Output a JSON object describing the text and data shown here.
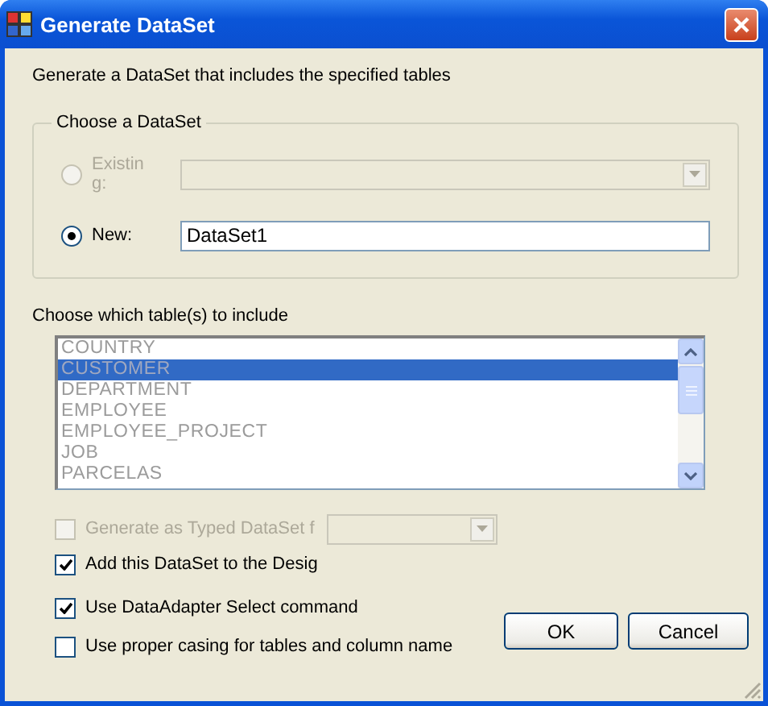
{
  "window": {
    "title": "Generate DataSet"
  },
  "description": "Generate a DataSet that includes the specified tables",
  "dataset_group": {
    "legend": "Choose a DataSet",
    "choices": [
      {
        "kind": "combo",
        "label": "Existing:",
        "selected": false,
        "disabled": true
      },
      {
        "kind": "field",
        "label": "New:",
        "selected": true,
        "disabled": false,
        "value": "DataSet1"
      }
    ]
  },
  "tables": {
    "label": "Choose which table(s) to include",
    "items": [
      {
        "name": "COUNTRY",
        "selected": false
      },
      {
        "name": "CUSTOMER",
        "selected": true
      },
      {
        "name": "DEPARTMENT",
        "selected": false
      },
      {
        "name": "EMPLOYEE",
        "selected": false
      },
      {
        "name": "EMPLOYEE_PROJECT",
        "selected": false
      },
      {
        "name": "JOB",
        "selected": false
      },
      {
        "name": "PARCELAS",
        "selected": false
      }
    ]
  },
  "options": [
    {
      "kind": "checkbox-combo",
      "label": "Generate as Typed DataSet f",
      "checked": false,
      "disabled": true
    },
    {
      "kind": "checkbox",
      "label": "Add this DataSet to the Desig",
      "checked": true,
      "disabled": false
    },
    {
      "kind": "checkbox",
      "label": "Use DataAdapter Select command",
      "checked": true,
      "disabled": false
    },
    {
      "kind": "checkbox",
      "label": "Use proper casing for tables and column name",
      "checked": false,
      "disabled": false
    }
  ],
  "buttons": [
    "OK",
    "Cancel"
  ]
}
